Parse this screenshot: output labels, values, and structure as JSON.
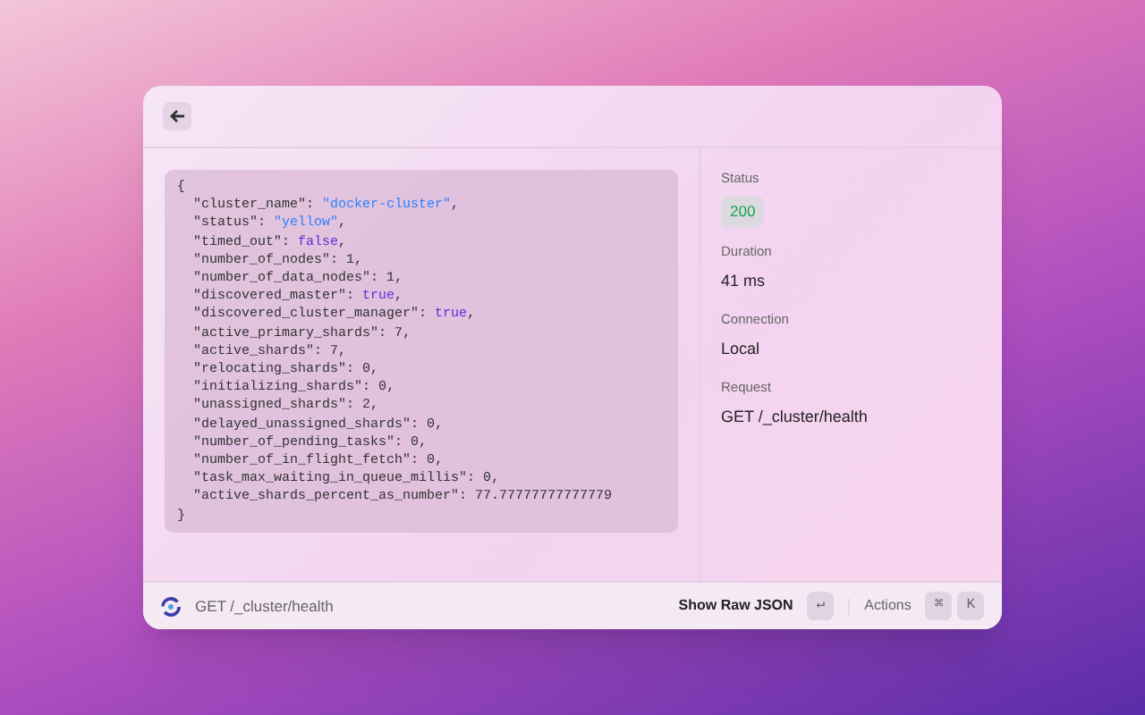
{
  "response": {
    "open": "{",
    "close": "}",
    "lines": [
      {
        "key": "\"cluster_name\":",
        "value": "\"docker-cluster\"",
        "end": ",",
        "kind": "string"
      },
      {
        "key": "\"status\":",
        "value": "\"yellow\"",
        "end": ",",
        "kind": "string"
      },
      {
        "key": "\"timed_out\":",
        "value": "false",
        "end": ",",
        "kind": "boolean"
      },
      {
        "key": "\"number_of_nodes\":",
        "value": "1",
        "end": ",",
        "kind": "number"
      },
      {
        "key": "\"number_of_data_nodes\":",
        "value": "1",
        "end": ",",
        "kind": "number"
      },
      {
        "key": "\"discovered_master\":",
        "value": "true",
        "end": ",",
        "kind": "boolean"
      },
      {
        "key": "\"discovered_cluster_manager\":",
        "value": "true",
        "end": ",",
        "kind": "boolean"
      },
      {
        "key": "\"active_primary_shards\":",
        "value": "7",
        "end": ",",
        "kind": "number"
      },
      {
        "key": "\"active_shards\":",
        "value": "7",
        "end": ",",
        "kind": "number"
      },
      {
        "key": "\"relocating_shards\":",
        "value": "0",
        "end": ",",
        "kind": "number"
      },
      {
        "key": "\"initializing_shards\":",
        "value": "0",
        "end": ",",
        "kind": "number"
      },
      {
        "key": "\"unassigned_shards\":",
        "value": "2",
        "end": ",",
        "kind": "number"
      },
      {
        "key": "\"delayed_unassigned_shards\":",
        "value": "0",
        "end": ",",
        "kind": "number"
      },
      {
        "key": "\"number_of_pending_tasks\":",
        "value": "0",
        "end": ",",
        "kind": "number"
      },
      {
        "key": "\"number_of_in_flight_fetch\":",
        "value": "0",
        "end": ",",
        "kind": "number"
      },
      {
        "key": "\"task_max_waiting_in_queue_millis\":",
        "value": "0",
        "end": ",",
        "kind": "number"
      },
      {
        "key": "\"active_shards_percent_as_number\":",
        "value": "77.77777777777779",
        "kind": "number"
      }
    ]
  },
  "details": [
    {
      "label": "Status",
      "value": "200",
      "kind": "badge"
    },
    {
      "label": "Duration",
      "value": "41 ms",
      "kind": "text"
    },
    {
      "label": "Connection",
      "value": "Local",
      "kind": "text"
    },
    {
      "label": "Request",
      "value": "GET /_cluster/health",
      "kind": "text"
    }
  ],
  "footer": {
    "title": "GET /_cluster/health",
    "primary_action": {
      "label": "Show Raw JSON",
      "keys": [
        "↵"
      ]
    },
    "secondary_action": {
      "label": "Actions",
      "keys": [
        "⌘",
        "K"
      ]
    }
  }
}
